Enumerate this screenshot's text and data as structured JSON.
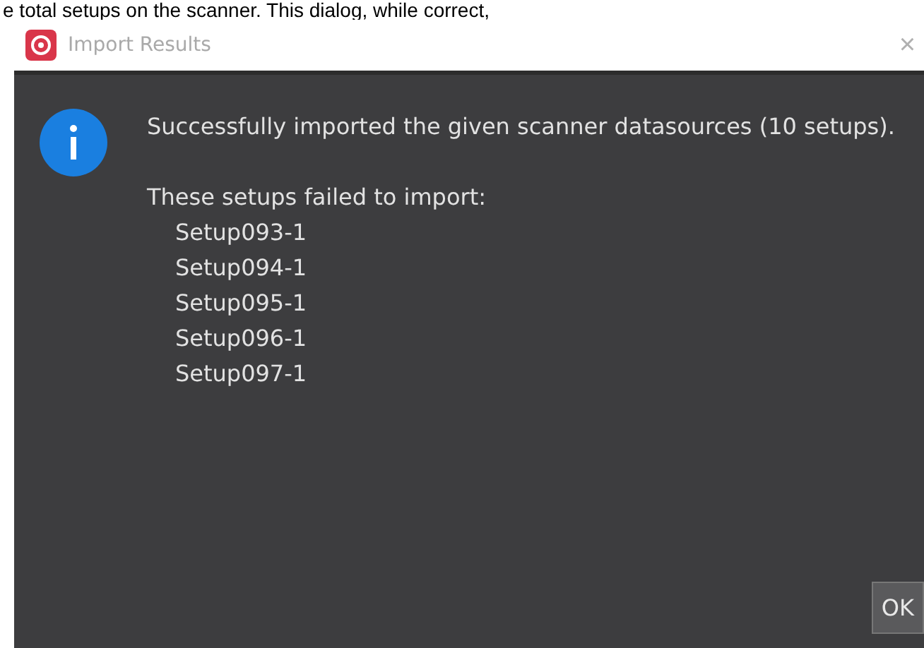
{
  "caption": "e total setups on the scanner. This dialog, while correct,",
  "window": {
    "title": "Import Results",
    "close": "×"
  },
  "message": {
    "summary": "Successfully imported the given scanner datasources (10 setups).",
    "failed_heading": "These setups failed to import:",
    "failed_setups": [
      "Setup093-1",
      "Setup094-1",
      "Setup095-1",
      "Setup096-1",
      "Setup097-1"
    ]
  },
  "buttons": [
    "OK"
  ]
}
